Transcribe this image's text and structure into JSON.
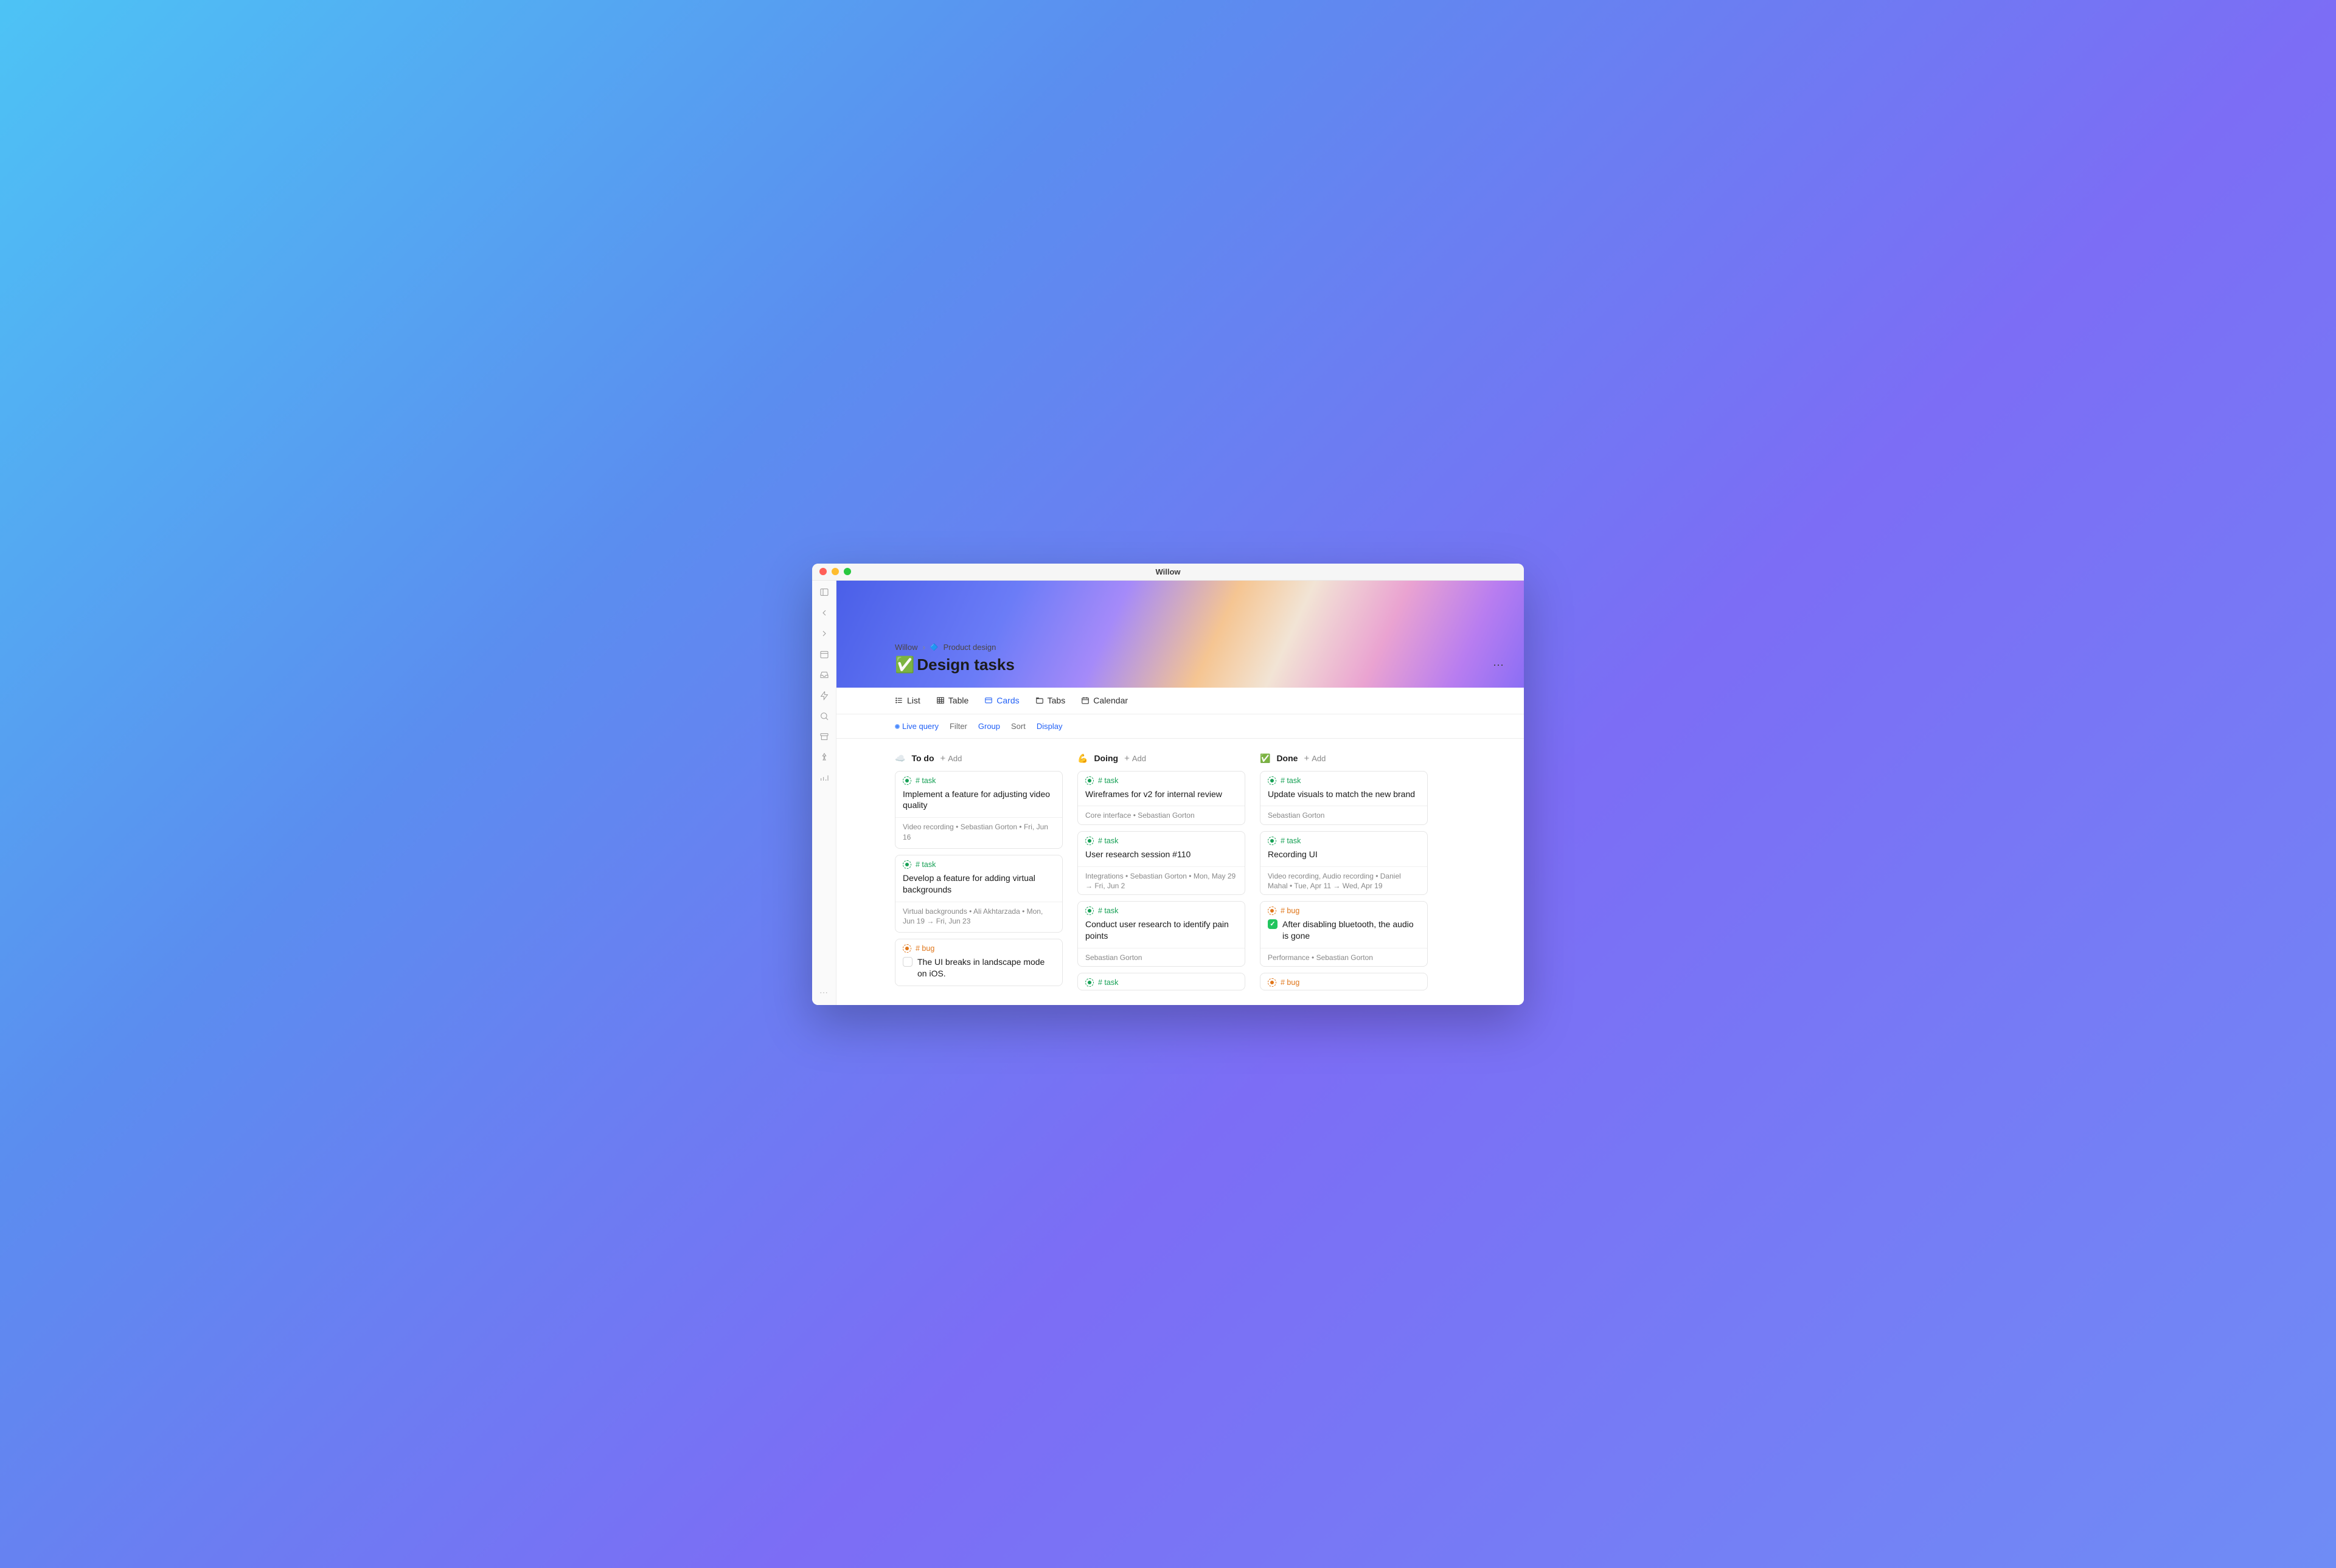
{
  "window_title": "Willow",
  "breadcrumb": {
    "root": "Willow",
    "section": "Product design"
  },
  "page_title": "Design tasks",
  "page_title_emoji": "✅",
  "view_tabs": {
    "list": "List",
    "table": "Table",
    "cards": "Cards",
    "tabs": "Tabs",
    "calendar": "Calendar"
  },
  "filters": {
    "live": "Live query",
    "filter": "Filter",
    "group": "Group",
    "sort": "Sort",
    "display": "Display"
  },
  "add_label": "Add",
  "columns": [
    {
      "emoji": "☁️",
      "title": "To do",
      "cards": [
        {
          "type": "task",
          "tag": "# task",
          "title": "Implement a feature for adjusting video quality",
          "meta": "Video recording  •  Sebastian Gorton  •  Fri, Jun 16"
        },
        {
          "type": "task",
          "tag": "# task",
          "title": "Develop a feature for adding virtual backgrounds",
          "meta": "Virtual backgrounds  •  Ali Akhtarzada  •  Mon, Jun 19 → Fri, Jun 23"
        },
        {
          "type": "bug",
          "tag": "# bug",
          "title": "The UI breaks in landscape mode on iOS.",
          "meta": "",
          "checkbox": "empty"
        }
      ]
    },
    {
      "emoji": "💪",
      "title": "Doing",
      "cards": [
        {
          "type": "task",
          "tag": "# task",
          "title": "Wireframes for v2 for internal review",
          "meta": "Core interface  •  Sebastian Gorton"
        },
        {
          "type": "task",
          "tag": "# task",
          "title": "User research session #110",
          "meta": "Integrations  •  Sebastian Gorton  •  Mon, May 29 → Fri, Jun 2"
        },
        {
          "type": "task",
          "tag": "# task",
          "title": "Conduct user research to identify pain points",
          "meta": "Sebastian Gorton"
        },
        {
          "type": "task",
          "tag": "# task",
          "title": "",
          "meta": "",
          "partial": true
        }
      ]
    },
    {
      "emoji": "✅",
      "title": "Done",
      "cards": [
        {
          "type": "task",
          "tag": "# task",
          "title": "Update visuals to match the new brand",
          "meta": "Sebastian Gorton"
        },
        {
          "type": "task",
          "tag": "# task",
          "title": "Recording UI",
          "meta": "Video recording, Audio recording  •  Daniel Mahal  •  Tue, Apr 11 → Wed, Apr 19"
        },
        {
          "type": "bug",
          "tag": "# bug",
          "title": "After disabling bluetooth, the audio is gone",
          "meta": "Performance  •  Sebastian Gorton",
          "checkbox": "done"
        },
        {
          "type": "bug",
          "tag": "# bug",
          "title": "",
          "meta": "",
          "partial": true
        }
      ]
    }
  ]
}
